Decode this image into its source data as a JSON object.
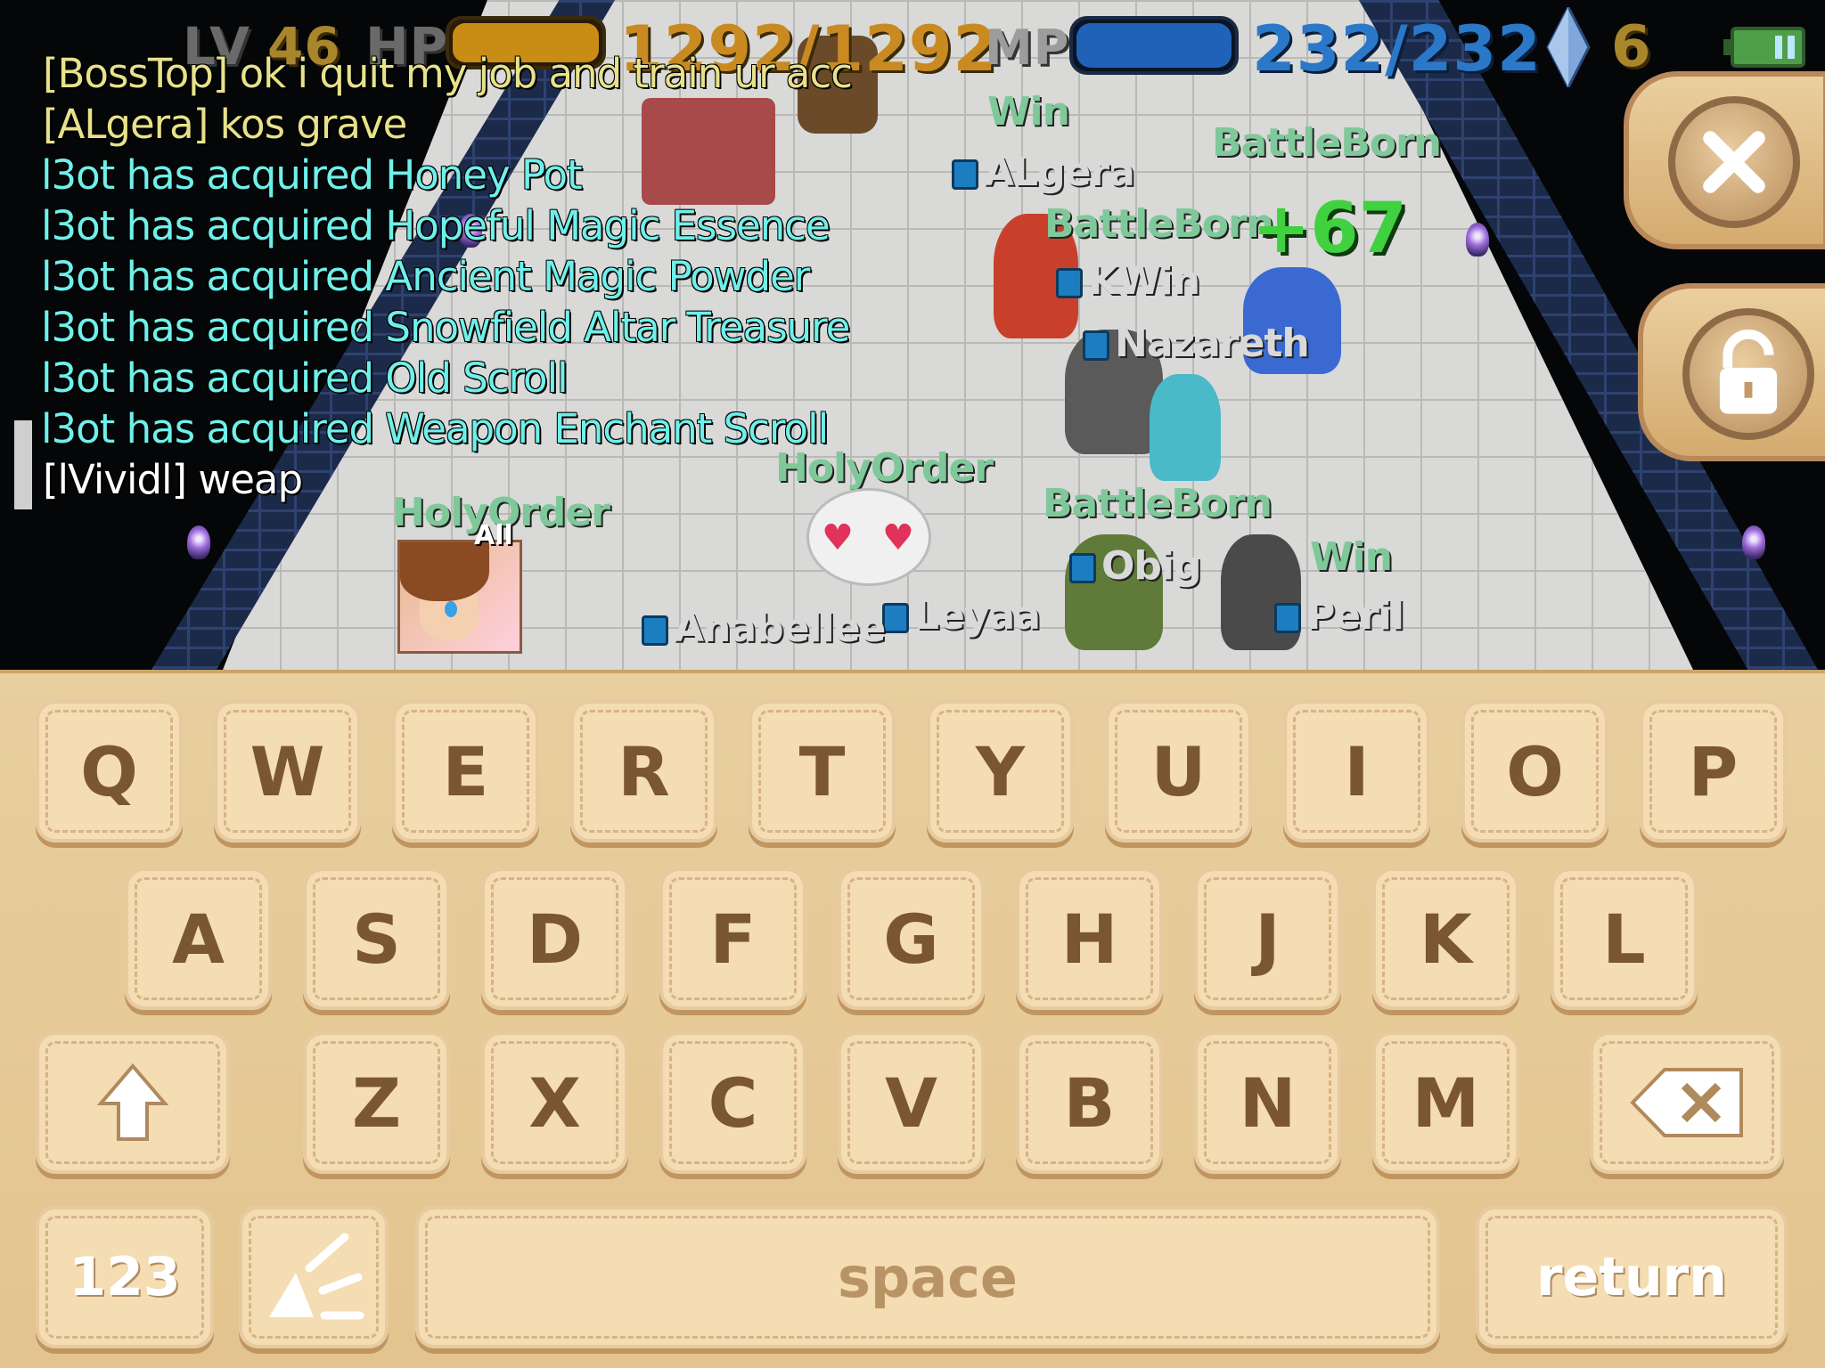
{
  "hud": {
    "level_label": "LV",
    "level_value": "46",
    "hp_label": "HP",
    "hp_value": "1292/1292",
    "hp_fraction": 1.0,
    "mp_label": "MP",
    "mp_value": "232/232",
    "mp_fraction": 1.0,
    "gem_count": "6"
  },
  "chat": [
    {
      "text": "[BossTop] ok i quit my job and train ur acc",
      "color": "yellow"
    },
    {
      "text": "[ALgera] kos grave",
      "color": "yellow"
    },
    {
      "text": "l3ot has acquired Honey Pot",
      "color": "cyan"
    },
    {
      "text": "l3ot has acquired Hopeful Magic Essence",
      "color": "cyan"
    },
    {
      "text": "l3ot has acquired Ancient Magic Powder",
      "color": "cyan"
    },
    {
      "text": "l3ot has acquired Snowfield Altar Treasure",
      "color": "cyan"
    },
    {
      "text": "l3ot has acquired Old Scroll",
      "color": "cyan"
    },
    {
      "text": "l3ot has acquired Weapon Enchant Scroll",
      "color": "cyan"
    },
    {
      "text": "[lVividl] weap",
      "color": "white"
    }
  ],
  "players": {
    "win1": "Win",
    "algera": "ALgera",
    "battleborn1": "BattleBorn",
    "battleborn2": "BattleBorn",
    "kwin": "KWin",
    "nazareth": "Nazareth",
    "holyorder1": "HolyOrder",
    "holyorder2": "HolyOrder",
    "battleborn3": "BattleBorn",
    "obig": "Obig",
    "win2": "Win",
    "peril": "Peril",
    "leyaa": "Leyaa",
    "anabellee": "Anabellee"
  },
  "damage_number": "+67",
  "avatar_tag": "All",
  "keyboard": {
    "row1": [
      "Q",
      "W",
      "E",
      "R",
      "T",
      "Y",
      "U",
      "I",
      "O",
      "P"
    ],
    "row2": [
      "A",
      "S",
      "D",
      "F",
      "G",
      "H",
      "J",
      "K",
      "L"
    ],
    "row3": [
      "Z",
      "X",
      "C",
      "V",
      "B",
      "N",
      "M"
    ],
    "num_label": "123",
    "space_label": "space",
    "return_label": "return"
  },
  "colors": {
    "hp": "#c98c15",
    "mp": "#1f62b8",
    "chat_system": "#6ff0ea",
    "chat_player": "#e7e28a",
    "keyboard_bg": "#e8cf9f",
    "key_text": "#7a5633"
  },
  "icons": {
    "gem": "diamond-gem-icon",
    "battery": "battery-icon",
    "close": "close-icon",
    "lock": "unlock-icon",
    "shift": "shift-arrow-icon",
    "backspace": "backspace-icon",
    "emoji": "emote-icon"
  }
}
